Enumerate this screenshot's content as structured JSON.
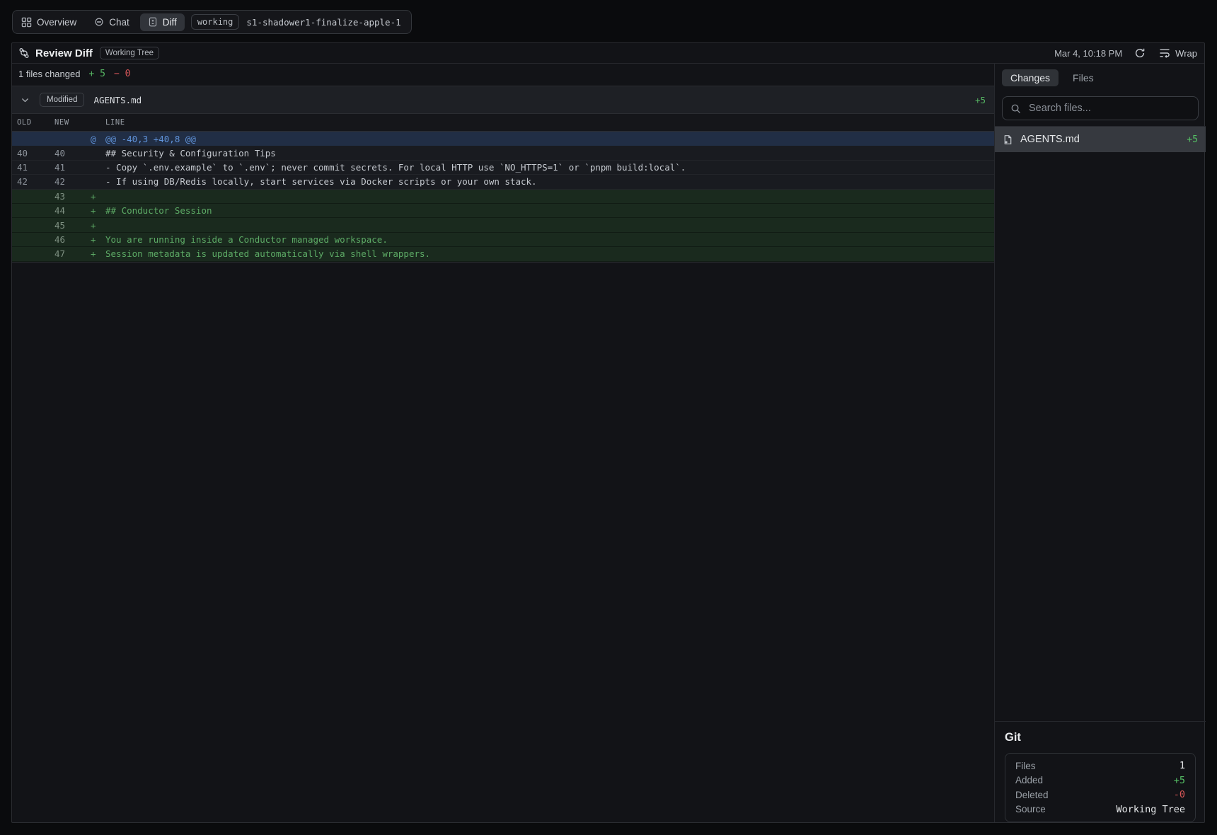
{
  "top_tabs": {
    "overview": "Overview",
    "chat": "Chat",
    "diff": "Diff",
    "working_badge": "working",
    "branch": "s1-shadower1-finalize-apple-1"
  },
  "header": {
    "title": "Review Diff",
    "badge": "Working Tree",
    "timestamp": "Mar 4, 10:18 PM",
    "wrap_label": "Wrap"
  },
  "stats_bar": {
    "files_changed": "1 files changed",
    "additions": "+ 5",
    "deletions": "− 0"
  },
  "file_card": {
    "status": "Modified",
    "filename": "AGENTS.md",
    "additions": "+5",
    "columns": {
      "old": "OLD",
      "new": "NEW",
      "line": "LINE"
    },
    "rows": [
      {
        "type": "hunk",
        "old": "",
        "new": "",
        "marker": "@",
        "text": "@@ -40,3 +40,8 @@"
      },
      {
        "type": "context",
        "old": "40",
        "new": "40",
        "marker": "",
        "text": "## Security & Configuration Tips"
      },
      {
        "type": "context",
        "old": "41",
        "new": "41",
        "marker": "",
        "text": "- Copy `.env.example` to `.env`; never commit secrets. For local HTTP use `NO_HTTPS=1` or `pnpm build:local`."
      },
      {
        "type": "context",
        "old": "42",
        "new": "42",
        "marker": "",
        "text": "- If using DB/Redis locally, start services via Docker scripts or your own stack."
      },
      {
        "type": "added",
        "old": "",
        "new": "43",
        "marker": "+",
        "text": ""
      },
      {
        "type": "added",
        "old": "",
        "new": "44",
        "marker": "+",
        "text": "## Conductor Session"
      },
      {
        "type": "added",
        "old": "",
        "new": "45",
        "marker": "+",
        "text": ""
      },
      {
        "type": "added",
        "old": "",
        "new": "46",
        "marker": "+",
        "text": "You are running inside a Conductor managed workspace."
      },
      {
        "type": "added",
        "old": "",
        "new": "47",
        "marker": "+",
        "text": "Session metadata is updated automatically via shell wrappers."
      }
    ]
  },
  "sidebar": {
    "tabs": {
      "changes": "Changes",
      "files": "Files"
    },
    "search_placeholder": "Search files...",
    "files": [
      {
        "name": "AGENTS.md",
        "additions": "+5"
      }
    ],
    "git": {
      "heading": "Git",
      "rows": [
        {
          "label": "Files",
          "value": "1",
          "color": "default"
        },
        {
          "label": "Added",
          "value": "+5",
          "color": "green"
        },
        {
          "label": "Deleted",
          "value": "-0",
          "color": "red"
        },
        {
          "label": "Source",
          "value": "Working Tree",
          "color": "default"
        }
      ]
    }
  },
  "colors": {
    "added_green": "#55b462",
    "deleted_red": "#d9575a",
    "hunk_blue": "#6093da"
  }
}
